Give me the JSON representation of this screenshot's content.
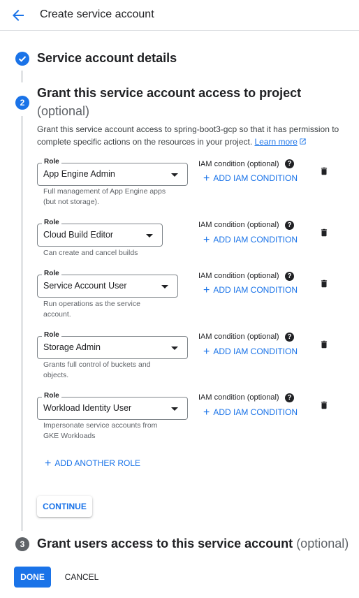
{
  "header": {
    "title": "Create service account",
    "back_icon": "arrow-back-icon"
  },
  "steps": [
    {
      "number": "1",
      "title": "Service account details",
      "optional": "",
      "state": "completed",
      "color": "#1a73e8"
    },
    {
      "number": "2",
      "title": "Grant this service account access to project",
      "optional": "(optional)",
      "state": "active",
      "color": "#1a73e8"
    },
    {
      "number": "3",
      "title": "Grant users access to this service account",
      "optional": "(optional)",
      "state": "pending",
      "color": "#5f6368"
    }
  ],
  "grant": {
    "description": "Grant this service account access to spring-boot3-gcp so that it has permission to complete specific actions on the resources in your project.",
    "learn_more": "Learn more",
    "role_label": "Role",
    "iam_condition_label": "IAM condition (optional)",
    "add_iam_condition": "ADD IAM CONDITION",
    "roles": [
      {
        "value": "App Engine Admin",
        "description": "Full management of App Engine apps (but not storage)."
      },
      {
        "value": "Cloud Build Editor",
        "description": "Can create and cancel builds"
      },
      {
        "value": "Service Account User",
        "description": "Run operations as the service account."
      },
      {
        "value": "Storage Admin",
        "description": "Grants full control of buckets and objects."
      },
      {
        "value": "Workload Identity User",
        "description": "Impersonate service accounts from GKE Workloads"
      }
    ],
    "add_another_role": "ADD ANOTHER ROLE",
    "continue": "CONTINUE"
  },
  "footer": {
    "done": "DONE",
    "cancel": "CANCEL"
  },
  "colors": {
    "accent": "#1a73e8",
    "text": "#202124",
    "muted": "#5f6368",
    "divider": "#dadce0"
  }
}
